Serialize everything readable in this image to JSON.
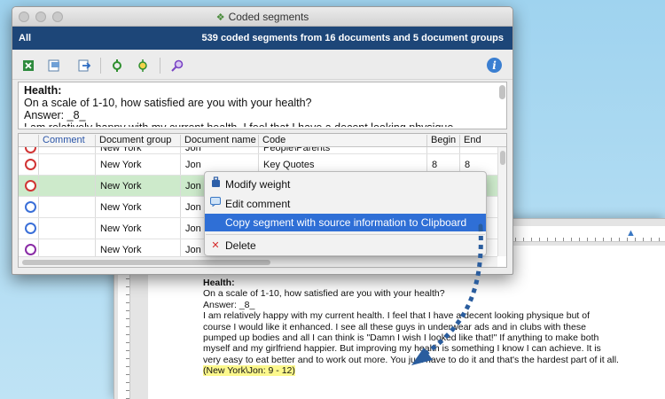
{
  "window": {
    "title": "Coded segments",
    "header_left": "All",
    "header_right": "539 coded segments from 16 documents and 5 document groups"
  },
  "toolbar": {
    "icons": [
      "export-excel-icon",
      "open-document-icon",
      "export-icon",
      "activate-codes-icon",
      "activate-documents-icon",
      "search-icon",
      "info-icon"
    ]
  },
  "preview": {
    "title": "Health:",
    "question": "On a scale of 1-10, how satisfied are you with your health?",
    "answer": "Answer: _8_",
    "cut_line": "I am relatively happy with my current health. I feel that I have a decent looking physique"
  },
  "table": {
    "columns": [
      "Comment",
      "Document group",
      "Document name",
      "Code",
      "Begin",
      "End"
    ],
    "rows": [
      {
        "circle": "#d13434",
        "group": "New York",
        "name": "Jon",
        "code": "People\\Parents",
        "begin": "",
        "end": ""
      },
      {
        "circle": "#d13434",
        "group": "New York",
        "name": "Jon",
        "code": "Key Quotes",
        "begin": "8",
        "end": "8"
      },
      {
        "circle": "#d13434",
        "group": "New York",
        "name": "Jon",
        "code": "",
        "begin": "",
        "end": ""
      },
      {
        "circle": "#3a6fd8",
        "group": "New York",
        "name": "Jon",
        "code": "",
        "begin": "",
        "end": ""
      },
      {
        "circle": "#3a6fd8",
        "group": "New York",
        "name": "Jon",
        "code": "",
        "begin": "",
        "end": ""
      },
      {
        "circle": "#8a2ca6",
        "group": "New York",
        "name": "Jon",
        "code": "",
        "begin": "",
        "end": ""
      },
      {
        "circle": "#8a2ca6",
        "group": "New York",
        "name": "Jon",
        "code": "",
        "begin": "",
        "end": ""
      }
    ]
  },
  "context_menu": {
    "modify_weight": "Modify weight",
    "edit_comment": "Edit comment",
    "copy_segment": "Copy segment with source information to Clipboard",
    "delete": "Delete"
  },
  "document": {
    "title": "Health:",
    "question": "On a scale of 1-10, how satisfied are you with your health?",
    "answer": "Answer: _8_",
    "body": "I am relatively happy with my current health.  I feel that I have a decent looking physique but of course I would like it enhanced.  I see all these guys in underwear ads and in clubs with these pumped up bodies and all I can think is \"Damn I wish I looked like that!\"  If anything to make both myself and my girlfriend happier.  But improving my health is something I know I can achieve.  It is very easy to eat better and to work out more.  You just have to do it and that's the hardest part of it all.",
    "source_ref": "(New York\\Jon: 9 - 12)"
  },
  "colors": {
    "header_bg": "#1d4678",
    "selected_row": "#cdeacb",
    "menu_highlight": "#2f6fd6",
    "source_highlight": "#fcf88c",
    "arrow": "#2a5d9e"
  }
}
